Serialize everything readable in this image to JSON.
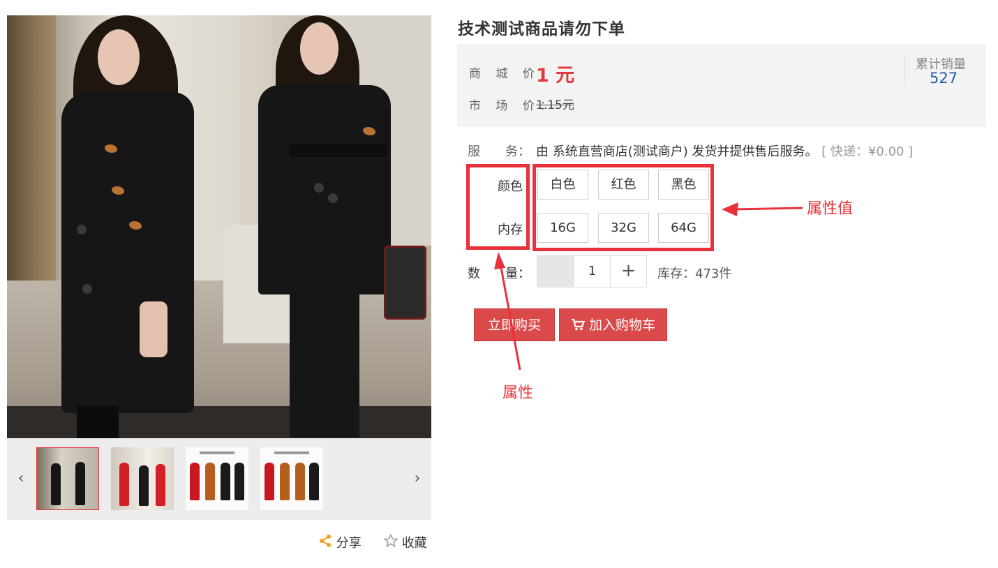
{
  "product": {
    "title": "技术测试商品请勿下单"
  },
  "price": {
    "mall_label": "商 城 价：",
    "mall_value": "1 元",
    "market_label": "市 场 价：",
    "market_value": "1.15元",
    "sales_label": "累计销量",
    "sales_value": "527"
  },
  "service": {
    "label": "服　　务：",
    "text": "由 系统直营商店(测试商户) 发货并提供售后服务。",
    "shipping": "[ 快递：¥0.00 ]"
  },
  "attributes": [
    {
      "name": "颜色",
      "options": [
        "白色",
        "红色",
        "黑色"
      ]
    },
    {
      "name": "内存",
      "options": [
        "16G",
        "32G",
        "64G"
      ]
    }
  ],
  "quantity": {
    "label": "数　　量：",
    "value": "1",
    "plus": "+",
    "stock": "库存：473件"
  },
  "buttons": {
    "buy_now": "立即购买",
    "add_cart": "加入购物车"
  },
  "gallery": {
    "prev": "‹",
    "next": "›",
    "share": "分享",
    "favorite": "收藏"
  },
  "annotations": {
    "attribute_values": "属性值",
    "attribute": "属性"
  },
  "colors": {
    "accent_red": "#e4393c",
    "button_red": "#db4a4a",
    "annotation_red": "#e8313a",
    "sales_blue": "#1f5ea8"
  }
}
